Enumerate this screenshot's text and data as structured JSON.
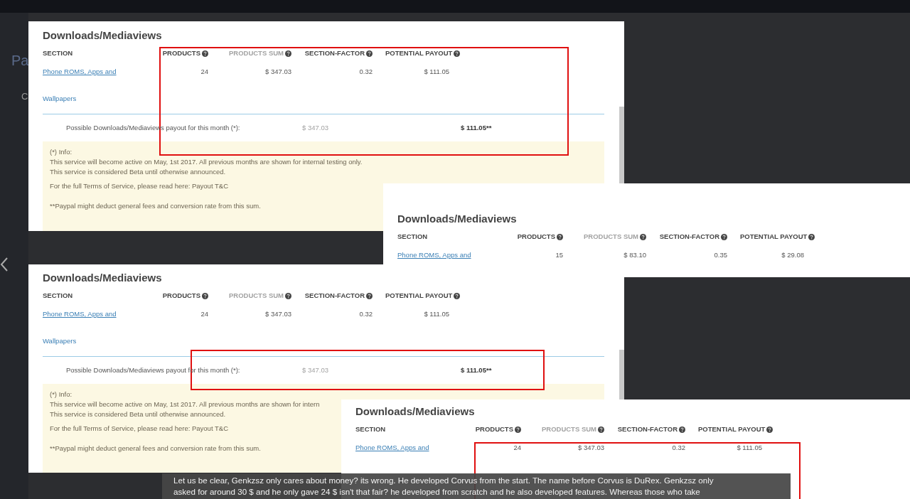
{
  "background": {
    "page_title_fragment": "Pa",
    "tab_fragment": "C"
  },
  "panels": [
    {
      "title": "Downloads/Mediaviews",
      "highlighted": true,
      "columns": [
        {
          "label": "SECTION",
          "help": false,
          "muted": false
        },
        {
          "label": "PRODUCTS",
          "help": true,
          "muted": false
        },
        {
          "label": "PRODUCTS SUM",
          "help": true,
          "muted": true
        },
        {
          "label": "SECTION-FACTOR",
          "help": true,
          "muted": false
        },
        {
          "label": "POTENTIAL PAYOUT",
          "help": true,
          "muted": false
        }
      ],
      "rows": [
        {
          "section": "Phone ROMS, Apps and",
          "section_cont": "Wallpapers",
          "products": "24",
          "sum": "$ 347.03",
          "factor": "0.32",
          "payout": "$ 111.05"
        }
      ],
      "total": {
        "label": "Possible Downloads/Mediaviews payout for this month (*):",
        "sum": "$ 347.03",
        "payout": "$ 111.05**"
      },
      "info": {
        "heading": "(*) Info:",
        "lines": [
          "This service will become active on May, 1st 2017. All previous months are shown for internal testing only.",
          "This service is considered Beta until otherwise announced."
        ],
        "terms": "For the full Terms of Service, please read here:",
        "link": "Payout T&C",
        "note": "**Paypal might deduct general fees and conversion rate from this sum."
      },
      "scrollbar": true
    },
    {
      "title": "Downloads/Mediaviews",
      "highlighted": false,
      "columns": [
        {
          "label": "SECTION",
          "help": false,
          "muted": false
        },
        {
          "label": "PRODUCTS",
          "help": true,
          "muted": false
        },
        {
          "label": "PRODUCTS SUM",
          "help": true,
          "muted": true
        },
        {
          "label": "SECTION-FACTOR",
          "help": true,
          "muted": false
        },
        {
          "label": "POTENTIAL PAYOUT",
          "help": true,
          "muted": false
        }
      ],
      "rows": [
        {
          "section": "Phone ROMS, Apps and",
          "products": "15",
          "sum": "$ 83.10",
          "factor": "0.35",
          "payout": "$ 29.08"
        }
      ],
      "scrollbar": false
    },
    {
      "title": "Downloads/Mediaviews",
      "highlighted": true,
      "columns": [
        {
          "label": "SECTION",
          "help": false,
          "muted": false
        },
        {
          "label": "PRODUCTS",
          "help": true,
          "muted": false
        },
        {
          "label": "PRODUCTS SUM",
          "help": true,
          "muted": true
        },
        {
          "label": "SECTION-FACTOR",
          "help": true,
          "muted": false
        },
        {
          "label": "POTENTIAL PAYOUT",
          "help": true,
          "muted": false
        }
      ],
      "rows": [
        {
          "section": "Phone ROMS, Apps and",
          "section_cont": "Wallpapers",
          "products": "24",
          "sum": "$ 347.03",
          "factor": "0.32",
          "payout": "$ 111.05"
        }
      ],
      "total": {
        "label": "Possible Downloads/Mediaviews payout for this month (*):",
        "sum": "$ 347.03",
        "payout": "$ 111.05**"
      },
      "info": {
        "heading": "(*) Info:",
        "lines": [
          "This service will become active on May, 1st 2017. All previous months are shown for intern",
          "This service is considered Beta until otherwise announced."
        ],
        "terms": "For the full Terms of Service, please read here:",
        "link": "Payout T&C",
        "note": "**Paypal might deduct general fees and conversion rate from this sum."
      },
      "scrollbar": true
    },
    {
      "title": "Downloads/Mediaviews",
      "highlighted": true,
      "columns": [
        {
          "label": "SECTION",
          "help": false,
          "muted": false
        },
        {
          "label": "PRODUCTS",
          "help": true,
          "muted": false
        },
        {
          "label": "PRODUCTS SUM",
          "help": true,
          "muted": true
        },
        {
          "label": "SECTION-FACTOR",
          "help": true,
          "muted": false
        },
        {
          "label": "POTENTIAL PAYOUT",
          "help": true,
          "muted": false
        }
      ],
      "rows": [
        {
          "section": "Phone ROMS, Apps and",
          "products": "24",
          "sum": "$ 347.03",
          "factor": "0.32",
          "payout": "$ 111.05"
        }
      ],
      "scrollbar": false
    }
  ],
  "caption": {
    "lines": [
      "Let us be clear, Genkzsz only cares about money? its wrong. He developed Corvus from the start. The name before Corvus is DuRex. Genkzsz only",
      "asked for around 30 $ and he only gave 24 $ isn't that fair? he developed from scratch and he also developed features. Whereas those who take"
    ]
  }
}
